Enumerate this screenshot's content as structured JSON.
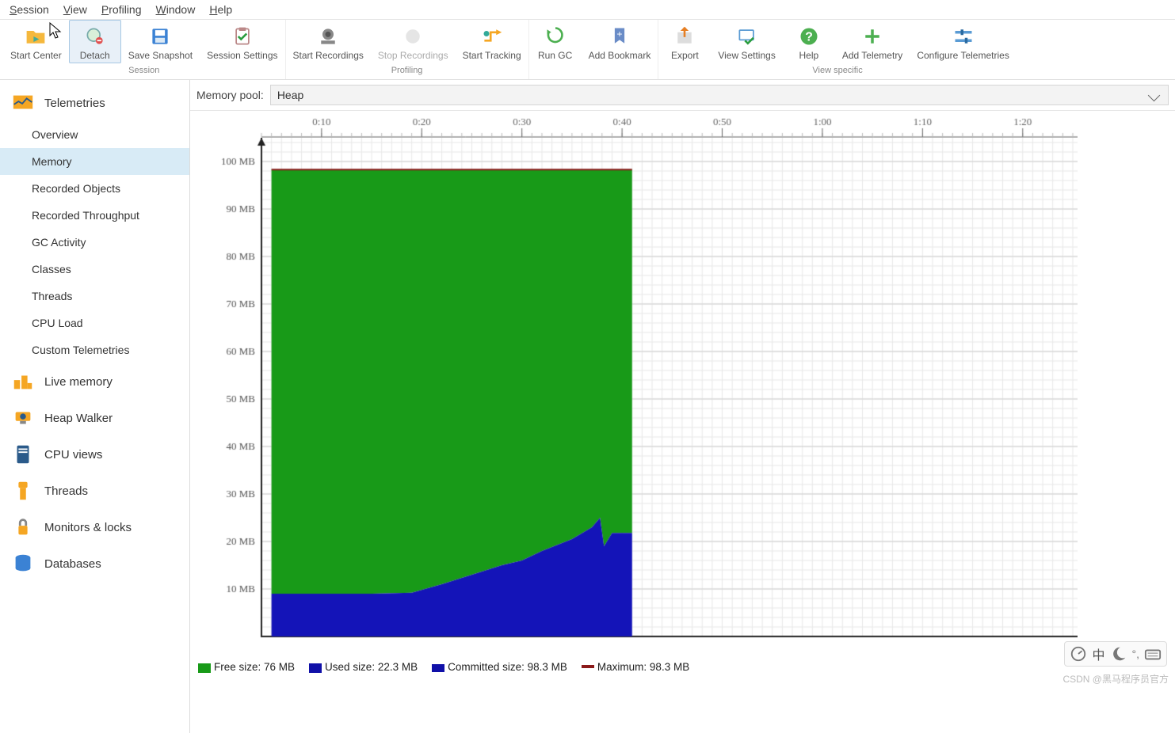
{
  "menu": {
    "session": "Session",
    "view": "View",
    "profiling": "Profiling",
    "window": "Window",
    "help": "Help"
  },
  "toolbar_groups": {
    "session": "Session",
    "profiling": "Profiling",
    "view": "View specific"
  },
  "buttons": {
    "startCenter": "Start\nCenter",
    "detach": "Detach",
    "saveSnapshot": "Save\nSnapshot",
    "sessionSettings": "Session\nSettings",
    "startRec": "Start\nRecordings",
    "stopRec": "Stop\nRecordings",
    "startTrack": "Start\nTracking",
    "runGC": "Run GC",
    "addBookmark": "Add\nBookmark",
    "export": "Export",
    "viewSettings": "View\nSettings",
    "help": "Help",
    "addTelemetry": "Add\nTelemetry",
    "configureTel": "Configure\nTelemetries"
  },
  "sidebar": {
    "telemetries": "Telemetries",
    "items": [
      "Overview",
      "Memory",
      "Recorded Objects",
      "Recorded Throughput",
      "GC Activity",
      "Classes",
      "Threads",
      "CPU Load",
      "Custom Telemetries"
    ],
    "sections": [
      "Live memory",
      "Heap Walker",
      "CPU views",
      "Threads",
      "Monitors & locks",
      "Databases"
    ]
  },
  "pool": {
    "label": "Memory pool:",
    "value": "Heap"
  },
  "chart_data": {
    "type": "area",
    "xlabel": "",
    "ylabel": "",
    "title": "",
    "y_ticks": [
      10,
      20,
      30,
      40,
      50,
      60,
      70,
      80,
      90,
      100
    ],
    "y_tick_suffix": " MB",
    "x_ticks": [
      "0:10",
      "0:20",
      "0:30",
      "0:40",
      "0:50",
      "1:00",
      "1:10",
      "1:20"
    ],
    "ylim": [
      0,
      105
    ],
    "x_range_sec": [
      4,
      85
    ],
    "data_range_sec": [
      5,
      41
    ],
    "committed_mb": 98.3,
    "maximum_mb": 98.3,
    "used_series_mb": [
      [
        5,
        9.0
      ],
      [
        10,
        9.0
      ],
      [
        15,
        9.0
      ],
      [
        19,
        9.2
      ],
      [
        22,
        11.0
      ],
      [
        25,
        13.0
      ],
      [
        28,
        15.0
      ],
      [
        30,
        16.0
      ],
      [
        32,
        18.0
      ],
      [
        35,
        20.5
      ],
      [
        37,
        23.0
      ],
      [
        37.8,
        25.0
      ],
      [
        38.2,
        19.0
      ],
      [
        39,
        21.8
      ],
      [
        40,
        21.8
      ],
      [
        41,
        21.8
      ]
    ],
    "free_now": 76.0,
    "used_now": 22.3
  },
  "legend": {
    "free": "Free size: 76 MB",
    "used": "Used size: 22.3 MB",
    "committed": "Committed size: 98.3 MB",
    "max": "Maximum: 98.3 MB",
    "colors": {
      "free": "#189a18",
      "used": "#1010a8",
      "committed": "#1010a8",
      "max": "#8b1a1a"
    }
  },
  "watermark": "CSDN @黑马程序员官方"
}
